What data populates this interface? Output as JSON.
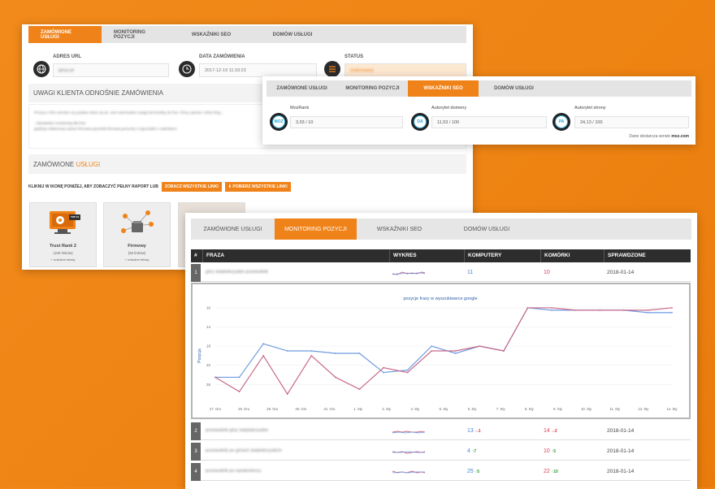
{
  "panel_orders": {
    "tabs": [
      "ZAMÓWIONE USŁUGI",
      "MONITORING POZYCJI",
      "WSKAŹNIKI SEO",
      "DOMÓW USŁUGI"
    ],
    "active_tab": 0,
    "url_label": "ADRES URL",
    "url_value": "jansz.pl",
    "date_label": "DATA ZAMÓWIENIA",
    "date_value": "2017-12-19 11:33:23",
    "status_label": "STATUS",
    "status_value": "realizowany",
    "notes_title": "UWAGI KLIENTA ODNOŚNIE ZAMÓWIENIA",
    "notes_lines": [
      "Proszę o info zwrotne czy podane dane są ok. oraz ewentualne uwagi lub korekty do fraz i firmy opisów i sitów blog...",
      "- Zamawiam monitoring dla fraz:",
      "gadżety reklamowe,odzież firmowa,upominki firmowe,prezenty z logo,kubki z nadrukiem"
    ],
    "services_title_main": "ZAMÓWIONE ",
    "services_title_accent": "USŁUGI",
    "hint": "KLIKNIJ W IKONĘ PONIŻEJ, ABY ZOBACZYĆ PEŁNY RAPORT LUB",
    "btn_all_links": "ZOBACZ WSZYSTKIE LINKI",
    "btn_download_links": "POBIERZ WSZYSTKIE LINKI",
    "cards": [
      {
        "name": "Trust Rank 2",
        "count": "(100 linków)",
        "note": "+ unikalne teksty"
      },
      {
        "name": "Firmowy",
        "count": "(50 linków)",
        "note": "+ unikalne teksty"
      }
    ],
    "badge_top": "TOP 10"
  },
  "panel_seo": {
    "tabs": [
      "ZAMÓWIONE USŁUGI",
      "MONITORING POZYCJI",
      "WSKAŹNIKI SEO",
      "DOMÓW USŁUGI"
    ],
    "active_tab": 2,
    "metrics": [
      {
        "label": "MozRank",
        "value": "3,93 / 10",
        "icon": "MOZ"
      },
      {
        "label": "Autorytet domeny",
        "value": "11,53 / 100",
        "icon": "DA"
      },
      {
        "label": "Autorytet strony",
        "value": "24,13 / 100",
        "icon": "PA"
      }
    ],
    "footer_text": "Dane dostarcza serwis ",
    "footer_source": "moz.com"
  },
  "panel_monitoring": {
    "tabs": [
      "ZAMÓWIONE USŁUGI",
      "MONITORING POZYCJI",
      "WSKAŹNIKI SEO",
      "DOMÓW USŁUGI"
    ],
    "active_tab": 1,
    "columns": [
      "#",
      "FRAZA",
      "WYKRES",
      "KOMPUTERY",
      "KOMÓRKI",
      "SPRAWDZONE"
    ],
    "rows": [
      {
        "num": "1",
        "phrase": "góry świętokrzyskie przewodnik",
        "desktop": "11",
        "desktop_delta": "",
        "mobile": "10",
        "mobile_delta": "",
        "checked": "2018-01-14"
      },
      {
        "num": "2",
        "phrase": "przewodnik góry świętokrzyskie",
        "desktop": "13",
        "desktop_delta": "↓-1",
        "mobile": "14",
        "mobile_delta": "↓-2",
        "checked": "2018-01-14"
      },
      {
        "num": "3",
        "phrase": "przewodnik po górach świętokrzyskich",
        "desktop": "4",
        "desktop_delta": "↑7",
        "mobile": "10",
        "mobile_delta": "↑5",
        "checked": "2018-01-14"
      },
      {
        "num": "4",
        "phrase": "przewodnik po sandomierzu",
        "desktop": "25",
        "desktop_delta": "↑5",
        "mobile": "22",
        "mobile_delta": "↑10",
        "checked": "2018-01-14"
      }
    ]
  },
  "chart_data": {
    "type": "line",
    "title": "pozycje frazy w wyszukiwarce google",
    "ylabel": "Pozycja",
    "xlabel": "",
    "categories": [
      "27. Gru",
      "28. Gru",
      "29. Gru",
      "30. Gru",
      "31. Gru",
      "1. Sty",
      "2. Sty",
      "3. Sty",
      "4. Sty",
      "5. Sty",
      "6. Sty",
      "7. Sty",
      "8. Sty",
      "9. Sty",
      "10. Sty",
      "11. Sty",
      "12. Sty",
      "13. Sty",
      "14. Sty"
    ],
    "x_ticks": [
      "27. Gru",
      "28. Gru",
      "29. Gru",
      "30. Gru",
      "31. Gru",
      "1. Sty",
      "2. Sty",
      "3. Sty",
      "5. Sty",
      "6. Sty",
      "7. Sty",
      "8. Sty",
      "9. Sty",
      "10. Sty",
      "11. Sty",
      "13. Sty",
      "14. Sty"
    ],
    "y_ticks": [
      10,
      14,
      18,
      22,
      26
    ],
    "ylim": [
      29,
      9.5
    ],
    "y_inverted": true,
    "series": [
      {
        "color": "#6f9be0",
        "values": [
          24.5,
          24.5,
          17.5,
          19,
          19,
          19.5,
          19.5,
          23.5,
          23,
          18,
          19.5,
          18,
          19,
          10,
          10.5,
          10.5,
          10.5,
          10.5,
          11,
          11
        ]
      },
      {
        "color": "#c86a8a",
        "values": [
          24.5,
          27.5,
          20,
          28,
          20,
          24.5,
          27,
          22.5,
          23.5,
          19,
          19,
          18,
          19,
          10,
          10,
          10.5,
          10.5,
          10.5,
          10.5,
          10
        ]
      }
    ]
  }
}
